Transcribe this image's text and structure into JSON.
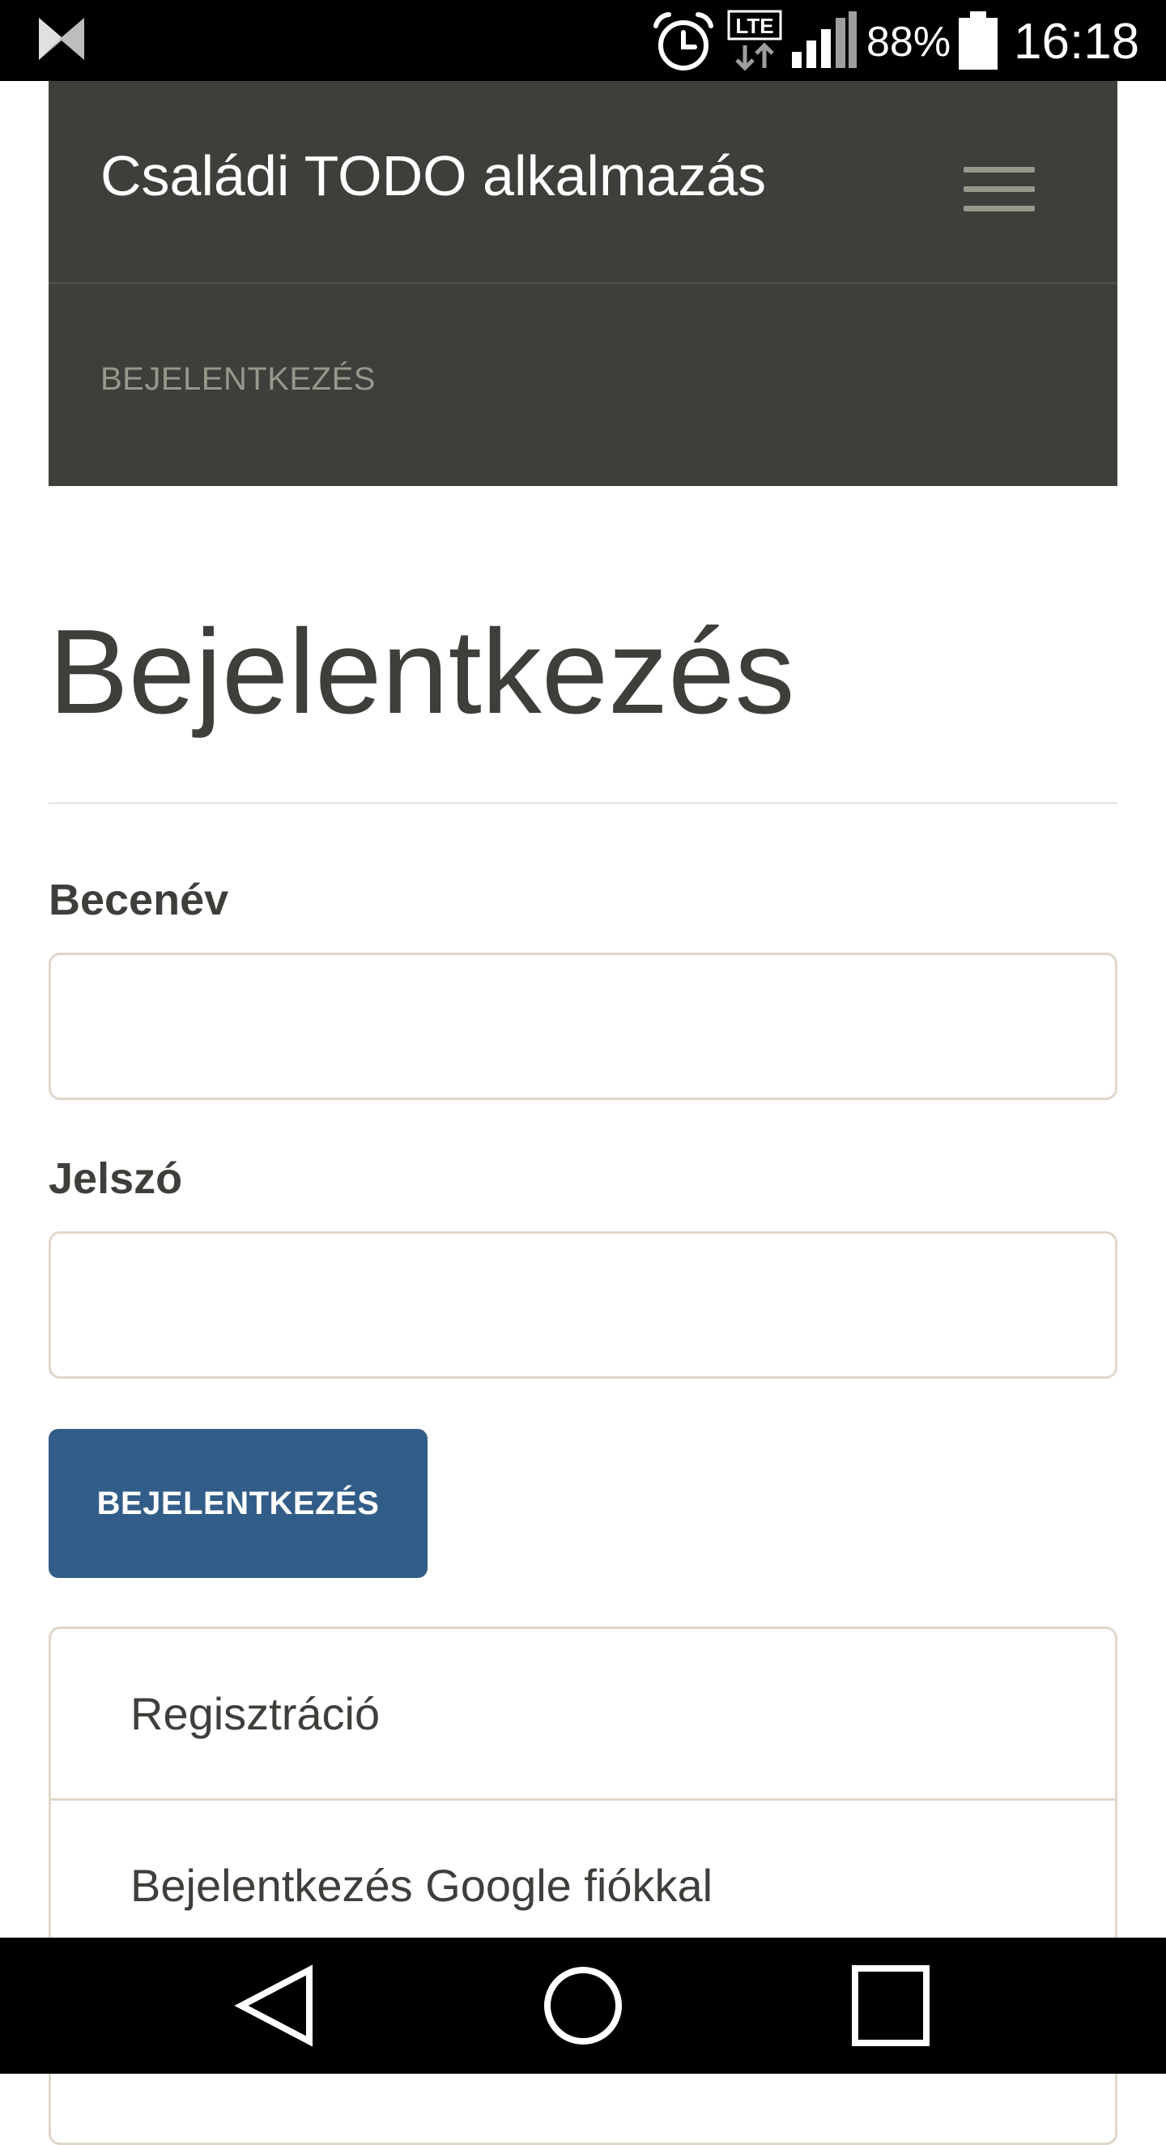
{
  "status_bar": {
    "battery_percent": "88%",
    "time": "16:18",
    "network_type": "LTE",
    "icons": [
      "app-notification-icon",
      "alarm-icon",
      "lte-icon",
      "signal-icon",
      "battery-icon"
    ]
  },
  "navbar": {
    "brand": "Családi TODO alkalmazás",
    "menu_icon": "hamburger-menu-icon",
    "links": [
      "BEJELENTKEZÉS"
    ]
  },
  "page": {
    "title": "Bejelentkezés"
  },
  "form": {
    "username_label": "Becenév",
    "username_value": "",
    "password_label": "Jelszó",
    "password_value": "",
    "submit_label": "BEJELENTKEZÉS"
  },
  "links": {
    "items": [
      "Regisztráció",
      "Bejelentkezés Google fiókkal"
    ]
  },
  "navigation_bar": {
    "icons": [
      "back-icon",
      "home-icon",
      "recents-icon"
    ]
  },
  "colors": {
    "navbar_bg": "#3e3f3a",
    "primary": "#325d88",
    "text": "#3e3f3a",
    "muted": "#98978b",
    "border": "#dfd7ca"
  }
}
